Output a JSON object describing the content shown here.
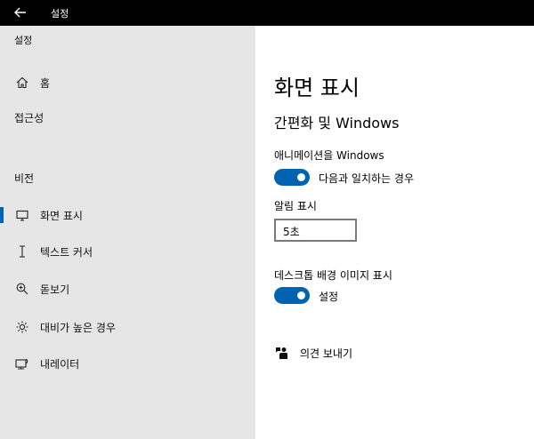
{
  "window": {
    "title": "설정",
    "back_icon": "arrow-left-icon"
  },
  "sidebar": {
    "app_label": "설정",
    "home": {
      "label": "홈",
      "icon": "home-icon"
    },
    "accessibility": {
      "label": "접근성"
    },
    "section_vision": "비전",
    "items": [
      {
        "label": "화면 표시",
        "icon": "monitor-icon",
        "selected": true
      },
      {
        "label": "텍스트 커서",
        "icon": "text-cursor-icon",
        "selected": false
      },
      {
        "label": "돋보기",
        "icon": "magnifier-icon",
        "selected": false
      },
      {
        "label": "대비가 높은 경우",
        "icon": "brightness-icon",
        "selected": false
      },
      {
        "label": "내레이터",
        "icon": "narrator-icon",
        "selected": false
      }
    ]
  },
  "main": {
    "title": "화면 표시",
    "subtitle": "간편화 및 Windows",
    "animations": {
      "label": "애니메이션을 Windows",
      "toggle_text": "다음과 일치하는 경우",
      "on": true
    },
    "notifications": {
      "label": "알림 표시",
      "value": "5초"
    },
    "background": {
      "label": "데스크톱 배경 이미지 표시",
      "toggle_text": "설정",
      "on": true
    },
    "feedback": {
      "label": "의견 보내기",
      "icon": "feedback-icon"
    }
  },
  "colors": {
    "accent": "#0063b1",
    "titlebar": "#000000",
    "sidebar": "#e6e6e6"
  }
}
